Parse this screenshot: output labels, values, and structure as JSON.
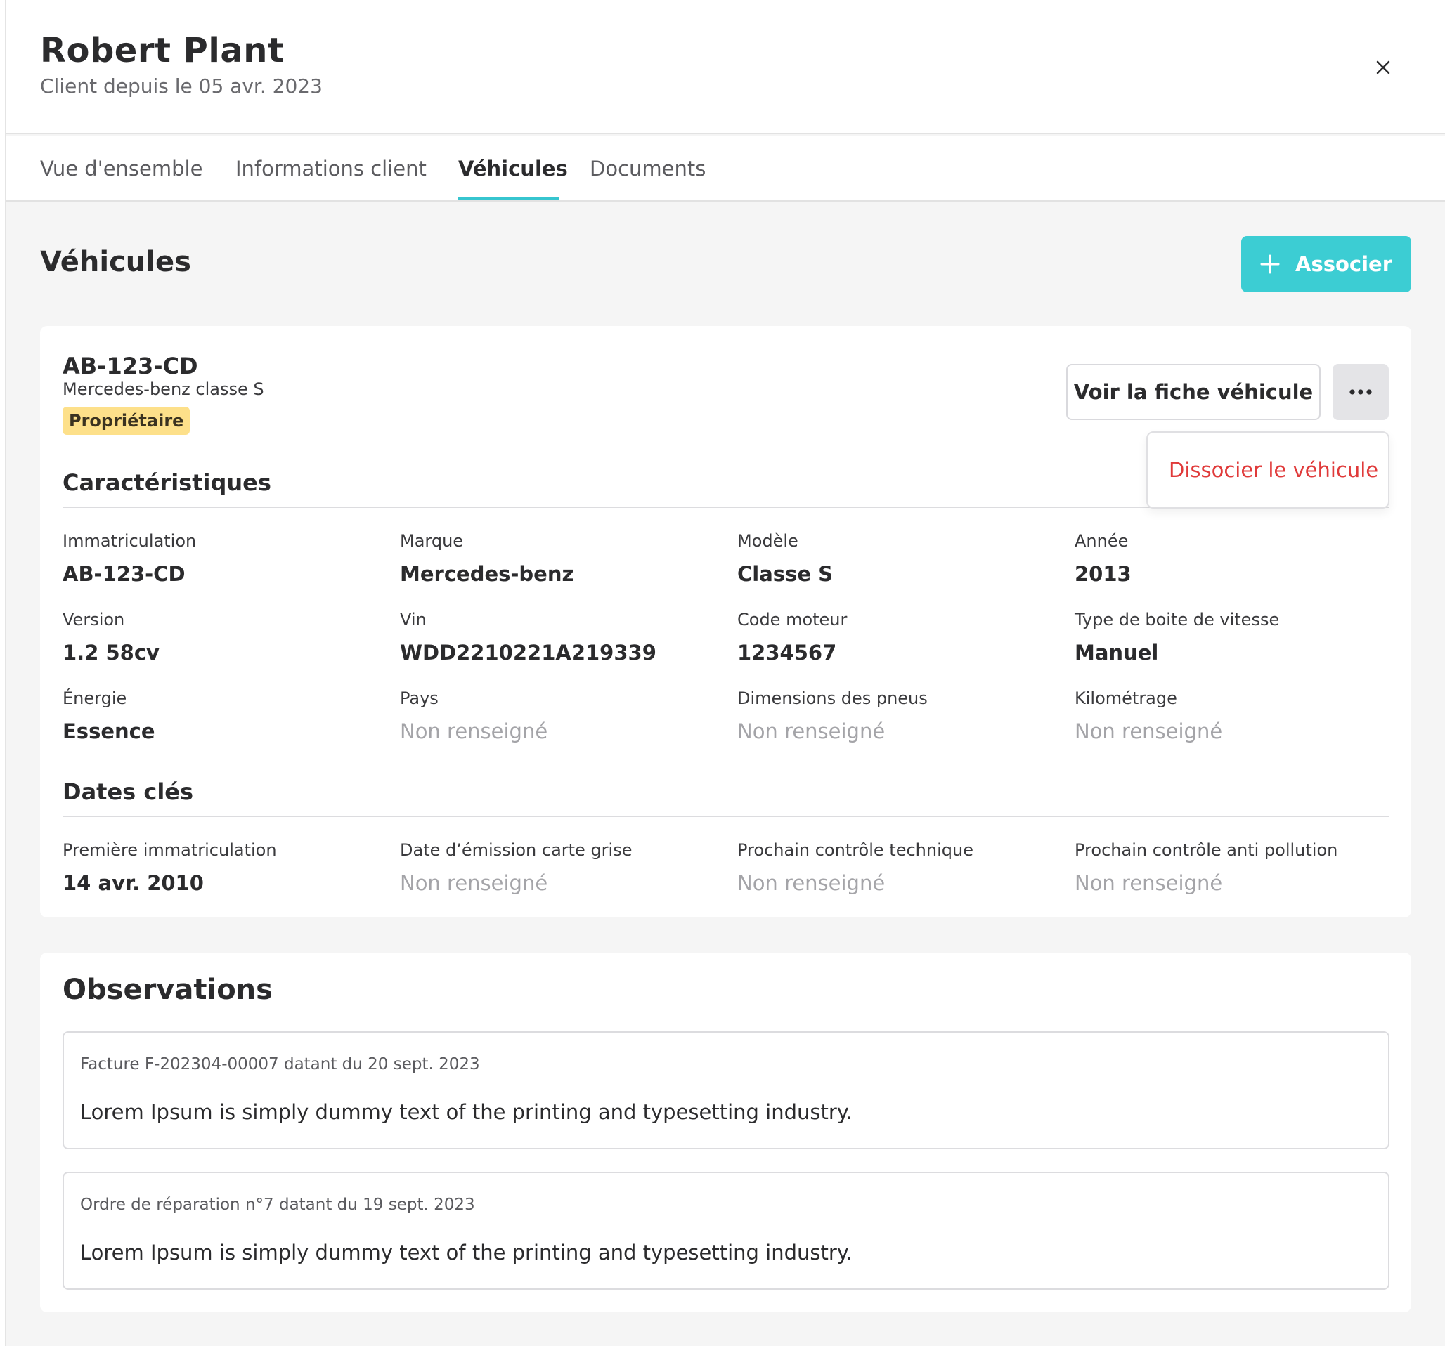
{
  "client": {
    "name": "Robert Plant",
    "since": "Client depuis le 05 avr. 2023"
  },
  "tabs": [
    {
      "label": "Vue d'ensemble",
      "active": false
    },
    {
      "label": "Informations client",
      "active": false
    },
    {
      "label": "Véhicules",
      "active": true
    },
    {
      "label": "Documents",
      "active": false
    }
  ],
  "section": {
    "title": "Véhicules",
    "associate_label": "Associer"
  },
  "vehicle": {
    "plate": "AB-123-CD",
    "model": "Mercedes-benz classe S",
    "badge": "Propriétaire",
    "view_button": "Voir la fiche véhicule",
    "more_icon": "more-horizontal-icon",
    "menu": {
      "dissociate": "Dissocier le véhicule"
    },
    "characteristics": {
      "title": "Caractéristiques",
      "fields": [
        {
          "label": "Immatriculation",
          "value": "AB-123-CD"
        },
        {
          "label": "Marque",
          "value": "Mercedes-benz"
        },
        {
          "label": "Modèle",
          "value": "Classe S"
        },
        {
          "label": "Année",
          "value": "2013"
        },
        {
          "label": "Version",
          "value": "1.2 58cv"
        },
        {
          "label": "Vin",
          "value": "WDD2210221A219339"
        },
        {
          "label": "Code moteur",
          "value": "1234567"
        },
        {
          "label": "Type de boite de vitesse",
          "value": "Manuel"
        },
        {
          "label": "Énergie",
          "value": "Essence"
        },
        {
          "label": "Pays",
          "value": "Non renseigné"
        },
        {
          "label": "Dimensions des pneus",
          "value": "Non renseigné"
        },
        {
          "label": "Kilométrage",
          "value": "Non renseigné"
        }
      ]
    },
    "key_dates": {
      "title": "Dates clés",
      "fields": [
        {
          "label": "Première immatriculation",
          "value": "14 avr. 2010"
        },
        {
          "label": "Date d’émission carte grise",
          "value": "Non renseigné"
        },
        {
          "label": "Prochain contrôle technique",
          "value": "Non renseigné"
        },
        {
          "label": "Prochain contrôle anti pollution",
          "value": "Non renseigné"
        }
      ]
    }
  },
  "observations": {
    "title": "Observations",
    "items": [
      {
        "meta": "Facture F-202304-00007 datant du 20 sept. 2023",
        "text": "Lorem Ipsum is simply dummy text of the printing and typesetting industry."
      },
      {
        "meta": "Ordre de réparation n°7 datant du 19 sept. 2023",
        "text": "Lorem Ipsum is simply dummy text of the printing and typesetting industry."
      }
    ]
  },
  "colors": {
    "accent": "#3ccdd3",
    "tab_underline": "#36c5cf",
    "danger": "#e03a3a",
    "badge_bg": "#fde08a",
    "empty_value": "#a4a4a8"
  }
}
